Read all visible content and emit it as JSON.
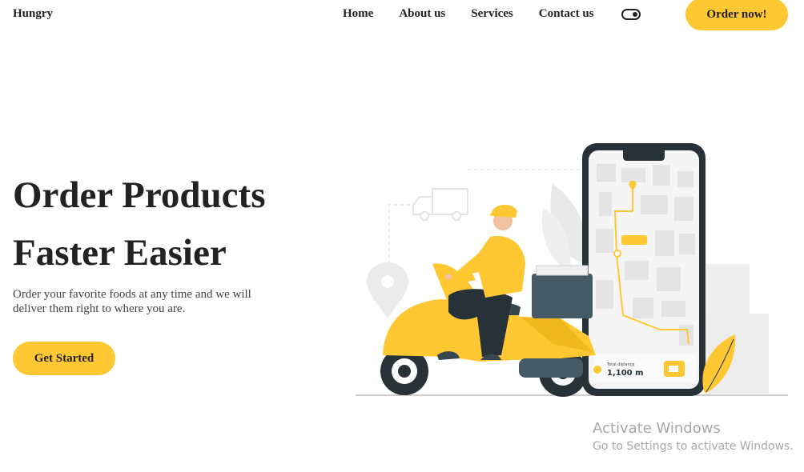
{
  "brand": "Hungry",
  "nav": {
    "items": [
      "Home",
      "About us",
      "Services",
      "Contact us"
    ],
    "order_button": "Order now!"
  },
  "hero": {
    "title_line1": "Order Products",
    "title_line2": "Faster Easier",
    "subtitle": "Order your favorite foods at any time and we will deliver them right to where you are.",
    "cta": "Get Started"
  },
  "phone": {
    "total_distance_label": "Total distance",
    "distance_value": "1,100 m"
  },
  "watermark": {
    "title": "Activate Windows",
    "subtitle": "Go to Settings to activate Windows."
  },
  "colors": {
    "accent": "#ffc832",
    "text": "#222222",
    "phone_frame": "#263238"
  }
}
